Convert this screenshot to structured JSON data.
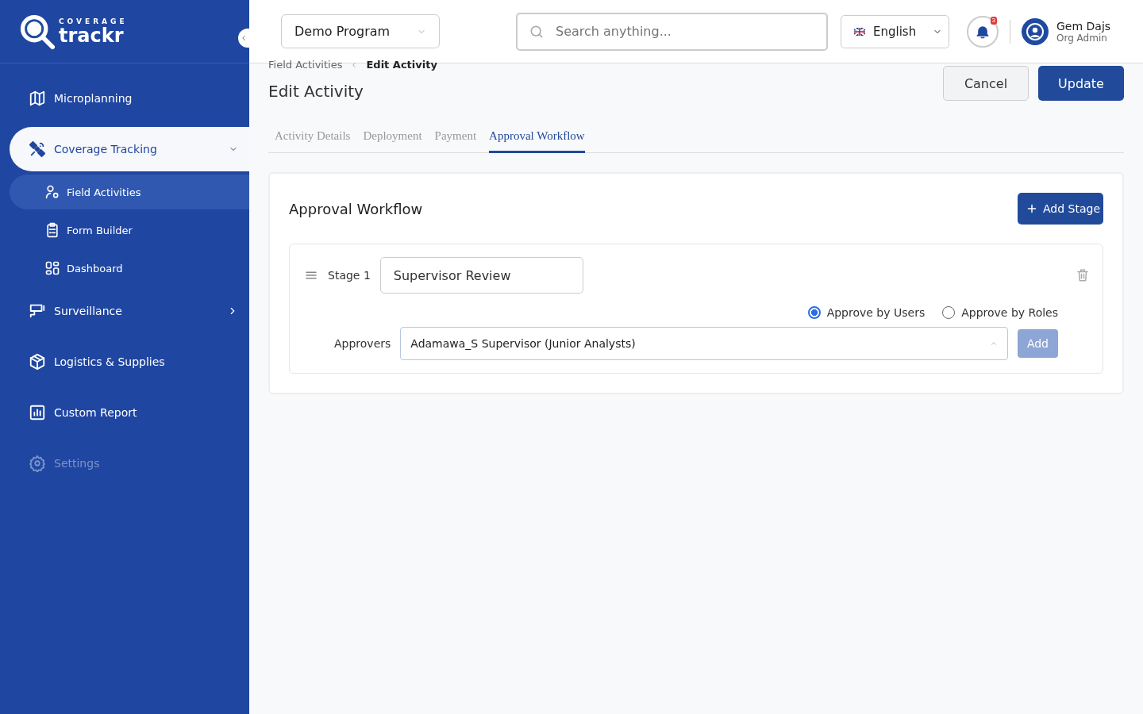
{
  "logo": {
    "overline": "COVERAGE",
    "wordmark": "trackr"
  },
  "sidebar": {
    "items": [
      {
        "label": "Microplanning",
        "selected": false,
        "disabled": false
      },
      {
        "label": "Coverage Tracking",
        "selected": true,
        "disabled": false,
        "expanded": true,
        "children": [
          {
            "label": "Field Activities",
            "selected": true
          },
          {
            "label": "Form Builder",
            "selected": false
          },
          {
            "label": "Dashboard",
            "selected": false
          }
        ]
      },
      {
        "label": "Surveillance",
        "selected": false,
        "disabled": false,
        "expanded": false
      },
      {
        "label": "Logistics & Supplies",
        "selected": false,
        "disabled": false
      },
      {
        "label": "Custom Report",
        "selected": false,
        "disabled": false
      },
      {
        "label": "Settings",
        "selected": false,
        "disabled": true
      }
    ]
  },
  "header": {
    "program": "Demo Program",
    "search": {
      "placeholder": "Search anything..."
    },
    "language": "English",
    "notifications": "3",
    "user": {
      "name": "Gem Dajs",
      "role": "Org Admin"
    }
  },
  "breadcrumb": [
    "Field Activities",
    "Edit Activity"
  ],
  "page_title": "Edit Activity",
  "actions": [
    {
      "label": "Cancel",
      "kind": "secondary"
    },
    {
      "label": "Update",
      "kind": "primary"
    }
  ],
  "tabs": [
    {
      "label": "Activity Details",
      "selected": false
    },
    {
      "label": "Deployment",
      "selected": false
    },
    {
      "label": "Payment",
      "selected": false
    },
    {
      "label": "Approval Workflow",
      "selected": true
    }
  ],
  "workflow": {
    "title": "Approval Workflow",
    "add_button": "Add Stage",
    "stages": [
      {
        "label": "Stage 1",
        "name": "Supervisor Review",
        "modes": [
          {
            "label": "Approve by Users",
            "selected": true
          },
          {
            "label": "Approve by Roles",
            "selected": false
          }
        ],
        "approvers_label": "Approvers",
        "approver": "Adamawa_S Supervisor (Junior Analysts)",
        "add": {
          "label": "Add",
          "disabled": true
        }
      }
    ]
  }
}
